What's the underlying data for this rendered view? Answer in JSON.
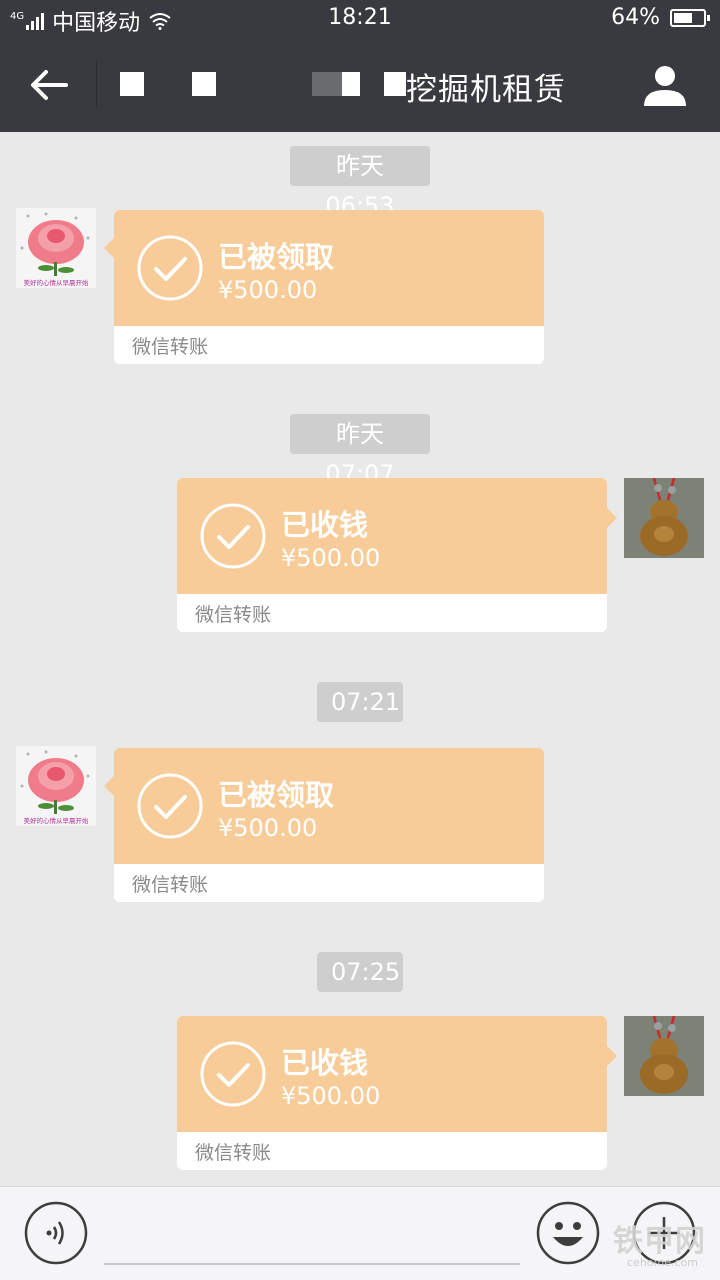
{
  "status_bar": {
    "network": "4G",
    "carrier": "中国移动",
    "time": "18:21",
    "battery": "64%",
    "battery_level": 0.64
  },
  "header": {
    "title": "挖掘机租赁",
    "back_icon": "back-arrow-icon",
    "profile_icon": "person-icon"
  },
  "messages": [
    {
      "timestamp": "昨天 06:53",
      "side": "left",
      "status": "已被领取",
      "amount": "¥500.00",
      "caption": "微信转账"
    },
    {
      "timestamp": "昨天 07:07",
      "side": "right",
      "status": "已收钱",
      "amount": "¥500.00",
      "caption": "微信转账"
    },
    {
      "timestamp": "07:21",
      "side": "left",
      "status": "已被领取",
      "amount": "¥500.00",
      "caption": "微信转账"
    },
    {
      "timestamp": "07:25",
      "side": "right",
      "status": "已收钱",
      "amount": "¥500.00",
      "caption": "微信转账"
    }
  ],
  "avatars": {
    "contact_caption": "美好的心情从早晨开始"
  },
  "input_bar": {
    "voice_icon": "voice-icon",
    "emoji_icon": "emoji-icon",
    "plus_icon": "plus-icon"
  },
  "watermark": {
    "text": "铁甲网",
    "sub": "cehome.com"
  },
  "colors": {
    "header_bg": "#393a3f",
    "chat_bg": "#e9e9e9",
    "transfer_card": "#f8cc98",
    "timestamp_bg": "#cecece"
  }
}
